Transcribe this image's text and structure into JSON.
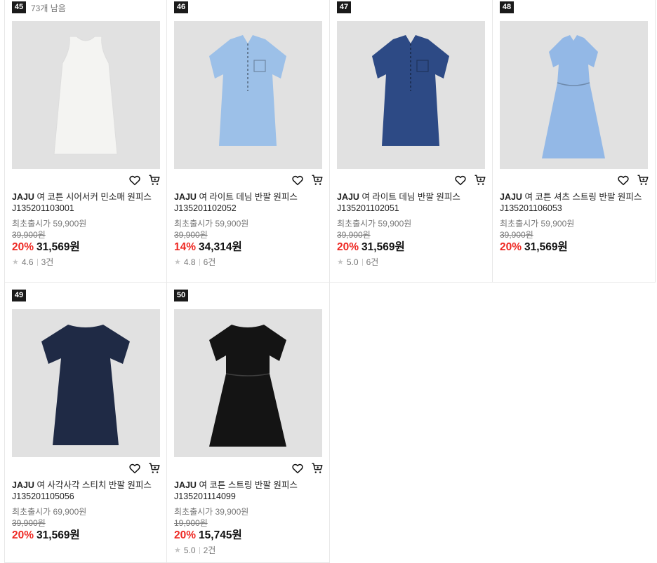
{
  "stock_label": "73개 남음",
  "products": [
    {
      "rank": "45",
      "brand": "JAJU",
      "name": "여 코튼 시어서커 민소매 원피스 J135201103001",
      "release": "최초출시가 59,900원",
      "original": "39,900원",
      "discount": "20%",
      "price": "31,569원",
      "rating": "4.6",
      "reviews": "3건",
      "dress": {
        "color": "#f4f4f2",
        "style": "sleeveless"
      }
    },
    {
      "rank": "46",
      "brand": "JAJU",
      "name": "여 라이트 데님 반팔 원피스 J135201102052",
      "release": "최초출시가 59,900원",
      "original": "39,900원",
      "discount": "14%",
      "price": "34,314원",
      "rating": "4.8",
      "reviews": "6건",
      "dress": {
        "color": "#9cc0e8",
        "style": "shirt"
      }
    },
    {
      "rank": "47",
      "brand": "JAJU",
      "name": "여 라이트 데님 반팔 원피스 J135201102051",
      "release": "최초출시가 59,900원",
      "original": "39,900원",
      "discount": "20%",
      "price": "31,569원",
      "rating": "5.0",
      "reviews": "6건",
      "dress": {
        "color": "#2d4a85",
        "style": "shirt"
      }
    },
    {
      "rank": "48",
      "brand": "JAJU",
      "name": "여 코튼 셔츠 스트링 반팔 원피스 J135201106053",
      "release": "최초출시가 59,900원",
      "original": "39,900원",
      "discount": "20%",
      "price": "31,569원",
      "rating": "",
      "reviews": "",
      "dress": {
        "color": "#93b8e6",
        "style": "long"
      }
    },
    {
      "rank": "49",
      "brand": "JAJU",
      "name": "여 사각사각 스티치 반팔 원피스 J135201105056",
      "release": "최초출시가 69,900원",
      "original": "39,900원",
      "discount": "20%",
      "price": "31,569원",
      "rating": "",
      "reviews": "",
      "dress": {
        "color": "#1f2a45",
        "style": "tee"
      }
    },
    {
      "rank": "50",
      "brand": "JAJU",
      "name": "여 코튼 스트링 반팔 원피스 J135201114099",
      "release": "최초출시가 39,900원",
      "original": "19,900원",
      "discount": "20%",
      "price": "15,745원",
      "rating": "5.0",
      "reviews": "2건",
      "dress": {
        "color": "#141414",
        "style": "tee-long"
      }
    }
  ],
  "icons": {
    "wishlist": "heart-icon",
    "cart": "cart-icon",
    "star": "star-icon"
  }
}
